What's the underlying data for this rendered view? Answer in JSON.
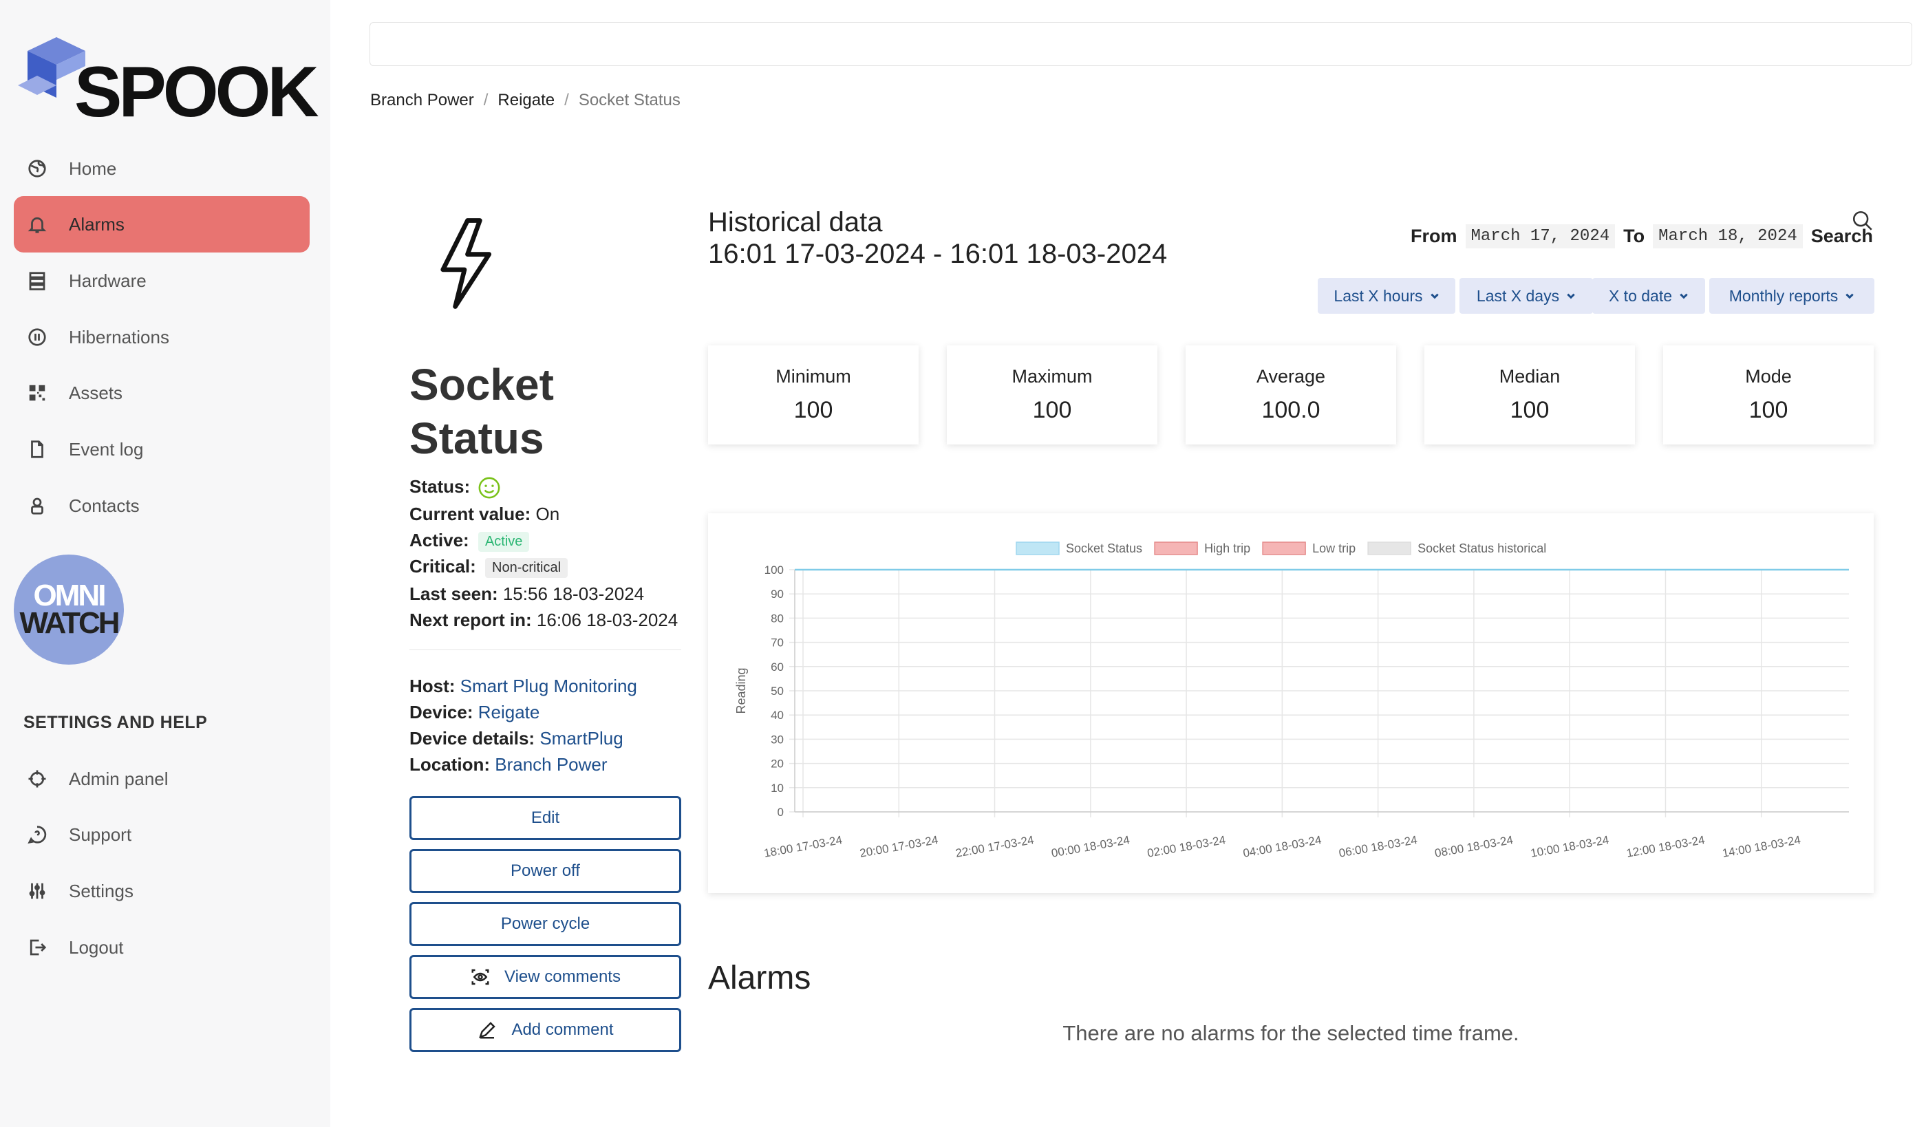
{
  "brand": {
    "logo_text": "SPOOK",
    "partner_line1": "OMNI",
    "partner_line2": "WATCH"
  },
  "nav": {
    "items": [
      {
        "label": "Home",
        "icon": "globe-icon"
      },
      {
        "label": "Alarms",
        "icon": "bell-icon",
        "active": true
      },
      {
        "label": "Hardware",
        "icon": "server-icon"
      },
      {
        "label": "Hibernations",
        "icon": "pause-circle-icon"
      },
      {
        "label": "Assets",
        "icon": "qr-code-icon"
      },
      {
        "label": "Event log",
        "icon": "file-icon"
      },
      {
        "label": "Contacts",
        "icon": "person-icon"
      }
    ],
    "settings_title": "SETTINGS AND HELP",
    "settings_items": [
      {
        "label": "Admin panel",
        "icon": "crosshair-icon"
      },
      {
        "label": "Support",
        "icon": "question-bubble-icon"
      },
      {
        "label": "Settings",
        "icon": "sliders-icon"
      },
      {
        "label": "Logout",
        "icon": "logout-icon"
      }
    ]
  },
  "breadcrumb": {
    "items": [
      "Branch Power",
      "Reigate",
      "Socket Status"
    ],
    "separator": "/"
  },
  "device": {
    "title_line1": "Socket",
    "title_line2": "Status",
    "status_label": "Status:",
    "current_value_label": "Current value:",
    "current_value": "On",
    "active_label": "Active:",
    "active_badge": "Active",
    "critical_label": "Critical:",
    "critical_badge": "Non-critical",
    "last_seen_label": "Last seen:",
    "last_seen": "15:56 18-03-2024",
    "next_report_label": "Next report in:",
    "next_report": "16:06 18-03-2024",
    "host_label": "Host:",
    "host": "Smart Plug Monitoring",
    "device_label": "Device:",
    "device": "Reigate",
    "details_label": "Device details:",
    "details": "SmartPlug",
    "location_label": "Location:",
    "location": "Branch Power"
  },
  "actions": {
    "edit": "Edit",
    "power_off": "Power off",
    "power_cycle": "Power cycle",
    "view_comments": "View comments",
    "add_comment": "Add comment"
  },
  "historical": {
    "title": "Historical data",
    "range": "16:01 17-03-2024 - 16:01 18-03-2024",
    "from_label": "From",
    "from_date": "March 17, 2024",
    "to_label": "To",
    "to_date": "March 18, 2024",
    "search_label": "Search",
    "dropdowns": [
      "Last X hours",
      "Last X days",
      "X to date",
      "Monthly reports"
    ]
  },
  "stats": [
    {
      "label": "Minimum",
      "value": "100"
    },
    {
      "label": "Maximum",
      "value": "100"
    },
    {
      "label": "Average",
      "value": "100.0"
    },
    {
      "label": "Median",
      "value": "100"
    },
    {
      "label": "Mode",
      "value": "100"
    }
  ],
  "chart_data": {
    "type": "line",
    "ylabel": "Reading",
    "ylim": [
      0,
      100
    ],
    "yticks": [
      0,
      10,
      20,
      30,
      40,
      50,
      60,
      70,
      80,
      90,
      100
    ],
    "xticks": [
      "18:00 17-03-24",
      "20:00 17-03-24",
      "22:00 17-03-24",
      "00:00 18-03-24",
      "02:00 18-03-24",
      "04:00 18-03-24",
      "06:00 18-03-24",
      "08:00 18-03-24",
      "10:00 18-03-24",
      "12:00 18-03-24",
      "14:00 18-03-24"
    ],
    "grid": true,
    "legend_position": "top",
    "series": [
      {
        "name": "Socket Status",
        "color": "#bfe6f5",
        "values": [
          100,
          100,
          100,
          100,
          100,
          100,
          100,
          100,
          100,
          100,
          100
        ]
      },
      {
        "name": "High trip",
        "color": "#f5b5b5",
        "values": []
      },
      {
        "name": "Low trip",
        "color": "#f5b5b5",
        "values": []
      },
      {
        "name": "Socket Status historical",
        "color": "#e6e6e6",
        "values": []
      }
    ]
  },
  "alarms": {
    "title": "Alarms",
    "empty_text": "There are no alarms for the selected time frame."
  },
  "colors": {
    "accent": "#e87471",
    "link": "#1e4f8c",
    "button_border": "#1e4f8c",
    "dropdown_bg": "#e4e8f7"
  }
}
